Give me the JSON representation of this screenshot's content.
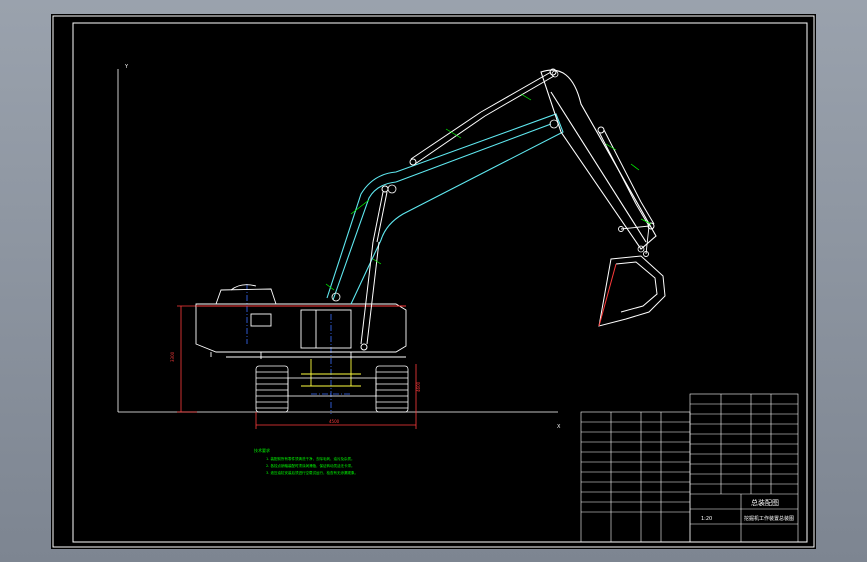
{
  "viewport": {
    "background": "#8a929e",
    "canvas_background": "#000000"
  },
  "drawing": {
    "subject": "hydraulic excavator general assembly",
    "colors": {
      "frame": "#ffffff",
      "boom": "#5fe8f0",
      "dimension": "#ff3b3b",
      "centerline": "#3a6dff",
      "part_balloon": "#00ff00",
      "hydraulic": "#ffffff",
      "track": "#ffffff",
      "accent": "#ffff40"
    },
    "axis_labels": {
      "y": "Y",
      "x": "X"
    },
    "dimension_values": {
      "overall_height": "3300",
      "track_length": "4500",
      "track_width": "4600"
    },
    "title_block": {
      "drawing_name": "挖掘机工作装置总装图",
      "scale": "1:20",
      "sheet_label": "总装配图"
    },
    "notes": {
      "heading": "技术要求",
      "lines": [
        "1. 装配前所有零件须清洗干净，去除毛刺、油污及杂质。",
        "2. 各铰点销轴装配时须涂润滑脂，保证转动灵活无卡滞。",
        "3. 液压油缸安装后须进行空载试运行，检查有无渗漏现象。"
      ]
    }
  }
}
